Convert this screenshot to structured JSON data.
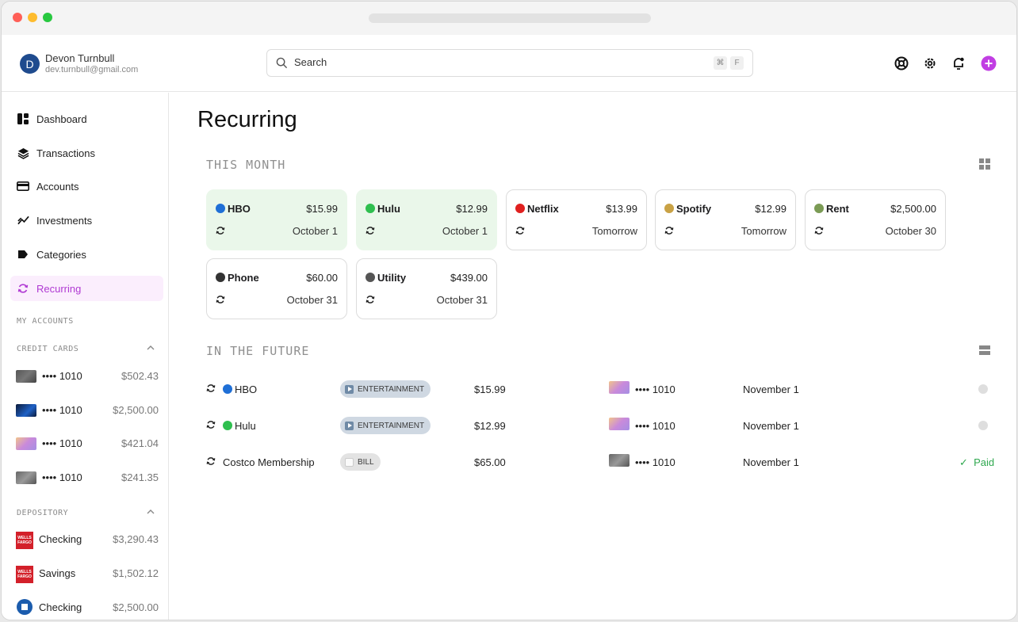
{
  "user": {
    "initial": "D",
    "name": "Devon Turnbull",
    "email": "dev.turnbull@gmail.com"
  },
  "search": {
    "placeholder": "Search",
    "shortcut_keys": [
      "⌘",
      "F"
    ]
  },
  "header_icons": [
    "support-icon",
    "settings-icon",
    "notifications-icon",
    "add-icon"
  ],
  "nav": [
    {
      "label": "Dashboard",
      "icon": "dashboard-icon"
    },
    {
      "label": "Transactions",
      "icon": "layers-icon"
    },
    {
      "label": "Accounts",
      "icon": "card-icon"
    },
    {
      "label": "Investments",
      "icon": "trend-icon"
    },
    {
      "label": "Categories",
      "icon": "tag-icon"
    },
    {
      "label": "Recurring",
      "icon": "recurring-icon",
      "active": true
    }
  ],
  "sidebar": {
    "my_accounts_label": "MY ACCOUNTS",
    "credit_cards_label": "CREDIT CARDS",
    "depository_label": "DEPOSITORY",
    "credit_cards": [
      {
        "label": "•••• 1010",
        "value": "$502.43"
      },
      {
        "label": "•••• 1010",
        "value": "$2,500.00"
      },
      {
        "label": "•••• 1010",
        "value": "$421.04"
      },
      {
        "label": "•••• 1010",
        "value": "$241.35"
      }
    ],
    "depository": [
      {
        "label": "Checking",
        "value": "$3,290.43",
        "bank_text": "WELLS FARGO"
      },
      {
        "label": "Savings",
        "value": "$1,502.12",
        "bank_text": "WELLS FARGO"
      },
      {
        "label": "Checking",
        "value": "$2,500.00"
      }
    ]
  },
  "page": {
    "title": "Recurring",
    "this_month_label": "THIS MONTH",
    "future_label": "IN THE FUTURE"
  },
  "this_month": [
    {
      "name": "HBO",
      "amount": "$15.99",
      "date": "October 1",
      "paid": true,
      "emoji_color": "#1f6fd6"
    },
    {
      "name": "Hulu",
      "amount": "$12.99",
      "date": "October 1",
      "paid": true,
      "emoji_color": "#2fbf4f"
    },
    {
      "name": "Netflix",
      "amount": "$13.99",
      "date": "Tomorrow",
      "paid": false,
      "emoji_color": "#e0201f"
    },
    {
      "name": "Spotify",
      "amount": "$12.99",
      "date": "Tomorrow",
      "paid": false,
      "emoji_color": "#c9a245"
    },
    {
      "name": "Rent",
      "amount": "$2,500.00",
      "date": "October 30",
      "paid": false,
      "emoji_color": "#7b9b55"
    },
    {
      "name": "Phone",
      "amount": "$60.00",
      "date": "October  31",
      "paid": false,
      "emoji_color": "#333333"
    },
    {
      "name": "Utility",
      "amount": "$439.00",
      "date": "October 31",
      "paid": false,
      "emoji_color": "#555555"
    }
  ],
  "future": [
    {
      "name": "HBO",
      "category": "ENTERTAINMENT",
      "amount": "$15.99",
      "account": "•••• 1010",
      "date": "November 1",
      "status": "pending",
      "emoji_color": "#1f6fd6"
    },
    {
      "name": "Hulu",
      "category": "ENTERTAINMENT",
      "amount": "$12.99",
      "account": "•••• 1010",
      "date": "November 1",
      "status": "pending",
      "emoji_color": "#2fbf4f"
    },
    {
      "name": "Costco Membership",
      "category": "BILL",
      "amount": "$65.00",
      "account": "•••• 1010",
      "date": "November 1",
      "status": "paid",
      "status_label": "Paid"
    }
  ],
  "colors": {
    "accent": "#b03ad3",
    "paid_bg": "#eaf7ea",
    "paid_text": "#2fa84f"
  }
}
